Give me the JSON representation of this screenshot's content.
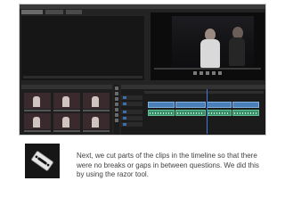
{
  "caption": "Next, we cut parts of the clips in the timeline so that there were no breaks or gaps in between questions.  We did this by using the razor tool.",
  "icons": {
    "razor_tool": "razor-blade-icon"
  },
  "colors": {
    "slide_background": "#ffffff",
    "app_background": "#232323",
    "video_clip": "#4a7fb8",
    "audio_clip": "#3a8f6a",
    "playhead": "#3e79d4",
    "caption_text": "#404040"
  }
}
